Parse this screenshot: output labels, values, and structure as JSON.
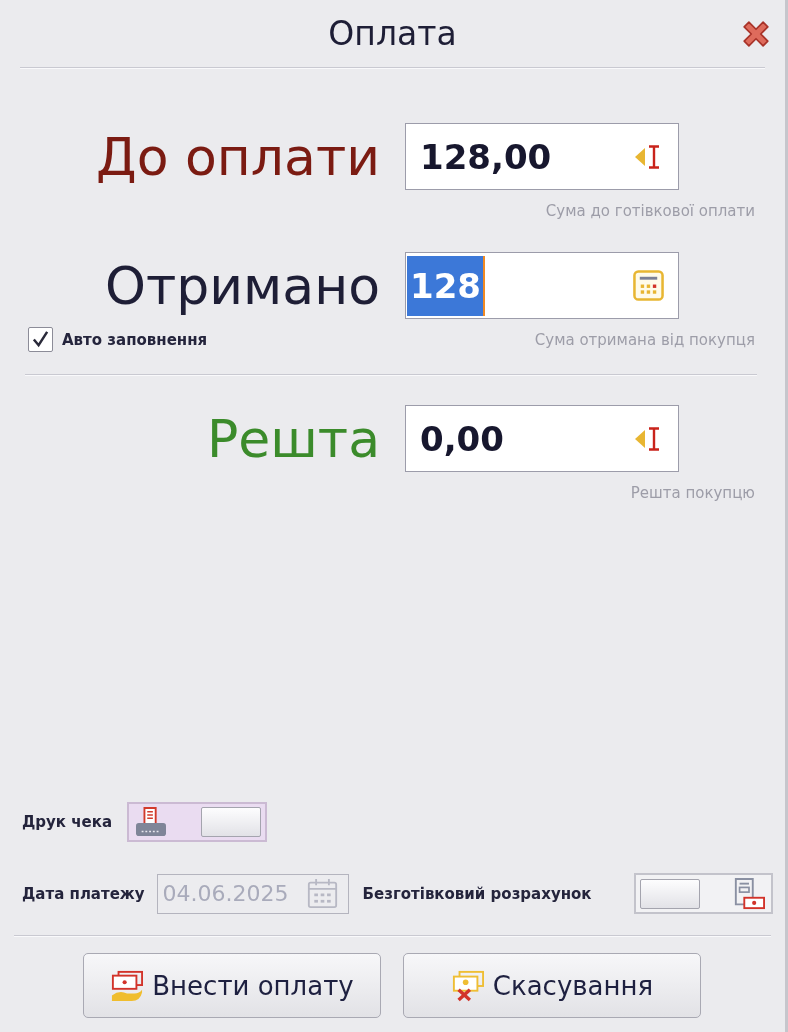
{
  "window": {
    "title": "Оплата"
  },
  "amounts": [
    {
      "kind": "due",
      "label": "До оплати",
      "value": "128,00",
      "text_selected": false,
      "hint": "Сума до готівкової оплати"
    },
    {
      "kind": "received",
      "label": "Отримано",
      "value": "128",
      "text_selected": true,
      "hint": "Сума отримана від покупця",
      "checkbox": {
        "label": "Авто заповнення",
        "checked": true
      }
    },
    {
      "kind": "change",
      "label": "Решта",
      "value": "0,00",
      "text_selected": false,
      "hint": "Решта покупцю"
    }
  ],
  "receipt_print": {
    "label": "Друк чека",
    "on": true
  },
  "payment_date": {
    "label": "Дата платежу",
    "value": "04.06.2025",
    "disabled": true
  },
  "cashless": {
    "label": "Безготівковий розрахунок",
    "on": false
  },
  "buttons": [
    {
      "kind": "pay",
      "label": "Внести оплату"
    },
    {
      "kind": "cancel",
      "label": "Скасування"
    }
  ]
}
